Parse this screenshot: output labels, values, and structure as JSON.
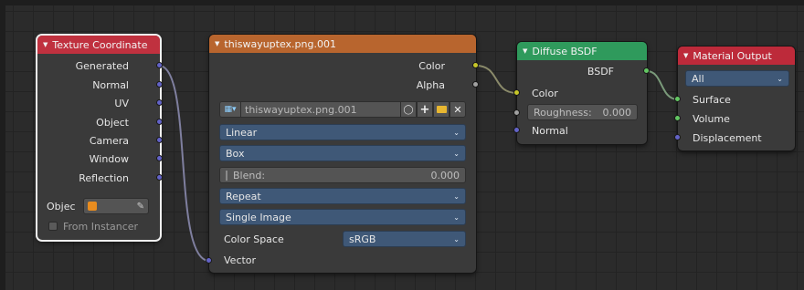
{
  "colors": {
    "texcoord_header": "#c0313f",
    "image_header": "#b8652e",
    "diffuse_header": "#2f9a5c",
    "output_header": "#bd2a3a",
    "vector_socket": "#6363c7",
    "color_socket": "#c7c729",
    "shader_socket": "#63c763"
  },
  "texcoord": {
    "title": "Texture Coordinate",
    "outputs": [
      "Generated",
      "Normal",
      "UV",
      "Object",
      "Camera",
      "Window",
      "Reflection"
    ],
    "object_label": "Objec",
    "from_instancer": "From Instancer"
  },
  "image": {
    "title": "thiswayuptex.png.001",
    "outputs": [
      "Color",
      "Alpha"
    ],
    "image_name": "thiswayuptex.png.001",
    "interpolation": "Linear",
    "projection": "Box",
    "blend_label": "Blend:",
    "blend_value": "0.000",
    "extension": "Repeat",
    "source": "Single Image",
    "color_space_label": "Color Space",
    "color_space_value": "sRGB",
    "vector_input": "Vector"
  },
  "diffuse": {
    "title": "Diffuse BSDF",
    "output": "BSDF",
    "color_input": "Color",
    "roughness_label": "Roughness:",
    "roughness_value": "0.000",
    "normal_input": "Normal"
  },
  "output": {
    "title": "Material Output",
    "target": "All",
    "inputs": [
      "Surface",
      "Volume",
      "Displacement"
    ]
  }
}
